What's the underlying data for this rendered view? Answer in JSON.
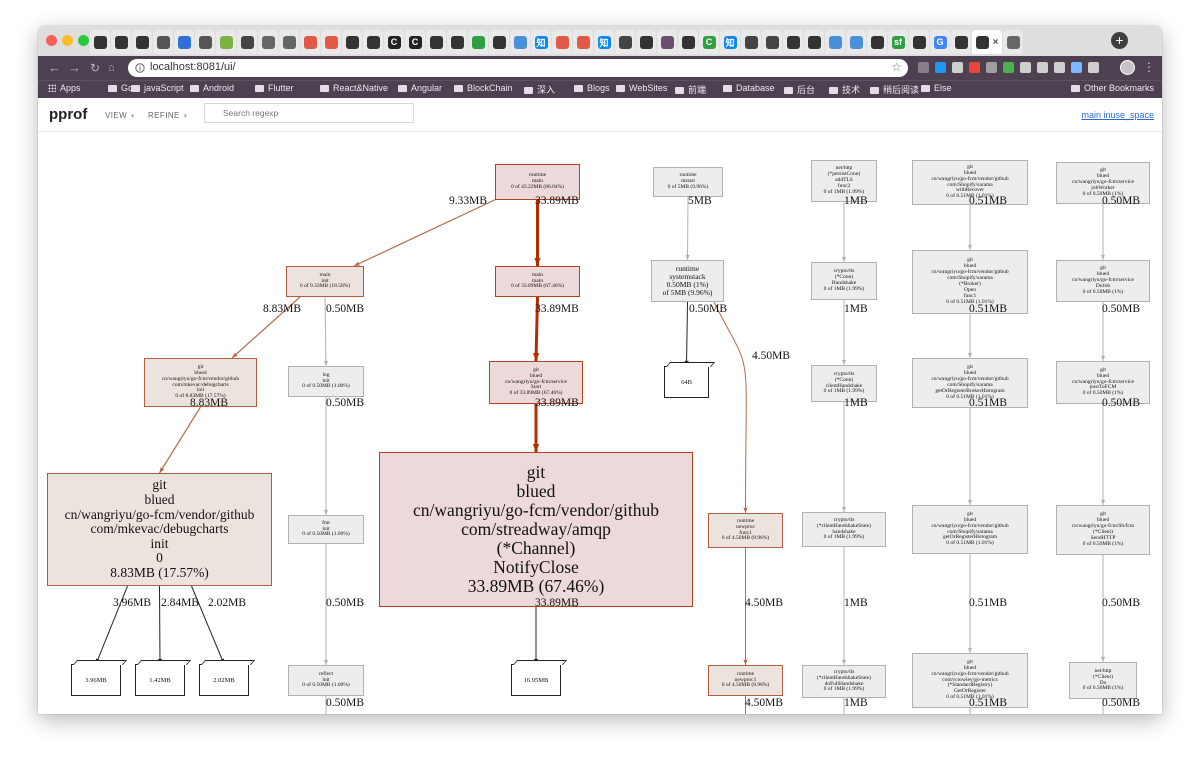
{
  "browser": {
    "url": "localhost:8081/ui/",
    "tab_icons": [
      {
        "glyph": "",
        "color": "#333333"
      },
      {
        "glyph": "",
        "color": "#333333"
      },
      {
        "glyph": "",
        "color": "#333333"
      },
      {
        "glyph": "",
        "color": "#555555"
      },
      {
        "glyph": "",
        "color": "#2f6fd6"
      },
      {
        "glyph": "",
        "color": "#555555"
      },
      {
        "glyph": "",
        "color": "#7cb342"
      },
      {
        "glyph": "",
        "color": "#444444"
      },
      {
        "glyph": "",
        "color": "#666666"
      },
      {
        "glyph": "",
        "color": "#666666"
      },
      {
        "glyph": "",
        "color": "#e05a47"
      },
      {
        "glyph": "",
        "color": "#e05a47"
      },
      {
        "glyph": "",
        "color": "#333333"
      },
      {
        "glyph": "",
        "color": "#333333"
      },
      {
        "glyph": "C",
        "color": "#222222"
      },
      {
        "glyph": "C",
        "color": "#222222"
      },
      {
        "glyph": "",
        "color": "#333333"
      },
      {
        "glyph": "",
        "color": "#333333"
      },
      {
        "glyph": "",
        "color": "#2ea043"
      },
      {
        "glyph": "",
        "color": "#333333"
      },
      {
        "glyph": "",
        "color": "#4a90d9"
      },
      {
        "glyph": "知",
        "color": "#0f88eb"
      },
      {
        "glyph": "",
        "color": "#e05a47"
      },
      {
        "glyph": "",
        "color": "#e05a47"
      },
      {
        "glyph": "知",
        "color": "#0f88eb"
      },
      {
        "glyph": "",
        "color": "#444444"
      },
      {
        "glyph": "",
        "color": "#333333"
      },
      {
        "glyph": "",
        "color": "#6b4d6f"
      },
      {
        "glyph": "",
        "color": "#333333"
      },
      {
        "glyph": "C",
        "color": "#2ea043"
      },
      {
        "glyph": "知",
        "color": "#0f88eb"
      },
      {
        "glyph": "",
        "color": "#444444"
      },
      {
        "glyph": "",
        "color": "#444444"
      },
      {
        "glyph": "",
        "color": "#333333"
      },
      {
        "glyph": "",
        "color": "#333333"
      },
      {
        "glyph": "",
        "color": "#4a90d9"
      },
      {
        "glyph": "",
        "color": "#4a90d9"
      },
      {
        "glyph": "",
        "color": "#333333"
      },
      {
        "glyph": "sf",
        "color": "#2ea043"
      },
      {
        "glyph": "",
        "color": "#333333"
      },
      {
        "glyph": "G",
        "color": "#4285f4"
      },
      {
        "glyph": "",
        "color": "#333333"
      },
      {
        "glyph": "",
        "color": "#333333"
      },
      {
        "glyph": "",
        "color": "#666666"
      }
    ],
    "extension_colors": [
      "#8a7d8c",
      "#2196f3",
      "#cfcfcf",
      "#e8453c",
      "#9e9e9e",
      "#4caf50",
      "#cfcfcf",
      "#cfcfcf",
      "#cfcfcf",
      "#7ab8ff",
      "#cfcfcf"
    ],
    "bookmarks": [
      "Apps",
      "Go",
      "javaScript",
      "Android",
      "Flutter",
      "React&Native",
      "Angular",
      "BlockChain",
      "深入",
      "Blogs",
      "WebSites",
      "前端",
      "Database",
      "后台",
      "技术",
      "稍后阅读",
      "Else"
    ],
    "other_bookmarks": "Other Bookmarks"
  },
  "pprof": {
    "logo": "pprof",
    "view_menu": "VIEW",
    "refine_menu": "REFINE",
    "search_placeholder": "Search regexp",
    "sample_type": "main inuse_space"
  },
  "graph": {
    "colors": {
      "hot_fill": "#edd9d9",
      "hot_border": "#b2421f",
      "warm_fill": "#ede3de",
      "warm_border": "#b25e3e",
      "cold_fill": "#ededed",
      "cold_border": "#b2b2b2",
      "hot_edge": "#b22e00",
      "warm_edge": "#b26d4e",
      "cold_edge": "#b2b2b2",
      "dark_edge": "#222222"
    },
    "nodes": [
      {
        "id": "n_runtime_main",
        "lines": [
          "runtime",
          "main",
          "0 of 43.22MB (86.04%)"
        ],
        "heat": "hot"
      },
      {
        "id": "n_main_init",
        "lines": [
          "main",
          "init",
          "0 of 9.33MB (18.58%)"
        ],
        "heat": "warm"
      },
      {
        "id": "n_main_main",
        "lines": [
          "main",
          "main",
          "0 of 33.89MB (67.46%)"
        ],
        "heat": "hot"
      },
      {
        "id": "n_debugcharts_init",
        "lines": [
          "git",
          "blued",
          "cn/wangriyu/go-fcm/vendor/github",
          "com/mkevac/debugcharts",
          "init",
          "0 of 8.83MB (17.57%)"
        ],
        "heat": "warm"
      },
      {
        "id": "n_log_init",
        "lines": [
          "log",
          "init",
          "0 of 0.50MB (1.00%)"
        ],
        "heat": "cold"
      },
      {
        "id": "n_service_start",
        "lines": [
          "git",
          "blued",
          "cn/wangriyu/go-fcm/service",
          "Start",
          "0 of 33.89MB (67.46%)"
        ],
        "heat": "hot"
      },
      {
        "id": "n_debugcharts_init0",
        "lines": [
          "git",
          "blued",
          "cn/wangriyu/go-fcm/vendor/github",
          "com/mkevac/debugcharts",
          "init",
          "0",
          "8.83MB (17.57%)"
        ],
        "heat": "warm"
      },
      {
        "id": "n_fmt_init",
        "lines": [
          "fmt",
          "init",
          "0 of 0.50MB (1.00%)"
        ],
        "heat": "cold"
      },
      {
        "id": "n_notifyclose",
        "lines": [
          "git",
          "blued",
          "cn/wangriyu/go-fcm/vendor/github",
          "com/streadway/amqp",
          "(*Channel)",
          "NotifyClose",
          "33.89MB (67.46%)"
        ],
        "heat": "hot"
      },
      {
        "id": "n_reflect_init",
        "lines": [
          "reflect",
          "init",
          "0 of 0.50MB (1.00%)"
        ],
        "heat": "cold"
      },
      {
        "id": "n_runtime_mstart",
        "lines": [
          "runtime",
          "mstart",
          "0 of 5MB (9.96%)"
        ],
        "heat": "cold"
      },
      {
        "id": "n_systemstack",
        "lines": [
          "runtime",
          "systemstack",
          "0.50MB (1%)",
          "of 5MB (9.96%)"
        ],
        "heat": "cold"
      },
      {
        "id": "n_newproc_func1",
        "lines": [
          "runtime",
          "newproc",
          "func1",
          "0 of 4.50MB (8.96%)"
        ],
        "heat": "warm"
      },
      {
        "id": "n_newproc1",
        "lines": [
          "runtime",
          "newproc1",
          "0 of 4.50MB (8.96%)"
        ],
        "heat": "warm"
      },
      {
        "id": "n_addtls",
        "lines": [
          "net/http",
          "(*persistConn)",
          "addTLS",
          "func2",
          "0 of 1MB (1.99%)"
        ],
        "heat": "cold"
      },
      {
        "id": "n_tls_handshake",
        "lines": [
          "crypto/tls",
          "(*Conn)",
          "Handshake",
          "0 of 1MB (1.99%)"
        ],
        "heat": "cold"
      },
      {
        "id": "n_client_handshake",
        "lines": [
          "crypto/tls",
          "(*Conn)",
          "clientHandshake",
          "0 of 1MB (1.99%)"
        ],
        "heat": "cold"
      },
      {
        "id": "n_hs_state_handshake",
        "lines": [
          "crypto/tls",
          "(*clientHandshakeState)",
          "handshake",
          "0 of 1MB (1.99%)"
        ],
        "heat": "cold"
      },
      {
        "id": "n_full_handshake",
        "lines": [
          "crypto/tls",
          "(*clientHandshakeState)",
          "doFullHandshake",
          "0 of 1MB (1.99%)"
        ],
        "heat": "cold"
      },
      {
        "id": "n_sarama_recover",
        "lines": [
          "git",
          "blued",
          "cn/wangriyu/go-fcm/vendor/github",
          "com/Shopify/sarama",
          "withRecover",
          "0 of 0.51MB (1.01%)"
        ],
        "heat": "cold"
      },
      {
        "id": "n_sarama_broker_open",
        "lines": [
          "git",
          "blued",
          "cn/wangriyu/go-fcm/vendor/github",
          "com/Shopify/sarama",
          "(*Broker)",
          "Open",
          "func1",
          "0 of 0.51MB (1.01%)"
        ],
        "heat": "cold"
      },
      {
        "id": "n_sarama_histogram",
        "lines": [
          "git",
          "blued",
          "cn/wangriyu/go-fcm/vendor/github",
          "com/Shopify/sarama",
          "getOrRegisterBrokerHistogram",
          "0 of 0.51MB (1.01%)"
        ],
        "heat": "cold"
      },
      {
        "id": "n_sarama_gethist",
        "lines": [
          "git",
          "blued",
          "cn/wangriyu/go-fcm/vendor/github",
          "com/Shopify/sarama",
          "getOrRegisterHistogram",
          "0 of 0.51MB (1.01%)"
        ],
        "heat": "cold"
      },
      {
        "id": "n_metrics_gethist",
        "lines": [
          "git",
          "blued",
          "cn/wangriyu/go-fcm/vendor/github",
          "com/rcrowley/go-metrics",
          "(*StandardRegistry)",
          "GetOrRegister",
          "0 of 0.51MB (1.01%)"
        ],
        "heat": "cold"
      },
      {
        "id": "n_job_worker",
        "lines": [
          "git",
          "blued",
          "cn/wangriyu/go-fcm/service",
          "jobWorker",
          "0 of 0.50MB (1%)"
        ],
        "heat": "cold"
      },
      {
        "id": "n_dojob",
        "lines": [
          "git",
          "blued",
          "cn/wangriyu/go-fcm/service",
          "DoJob",
          "0 of 0.50MB (1%)"
        ],
        "heat": "cold"
      },
      {
        "id": "n_posttofcm",
        "lines": [
          "git",
          "blued",
          "cn/wangriyu/go-fcm/service",
          "postToFCM",
          "0 of 0.50MB (1%)"
        ],
        "heat": "cold"
      },
      {
        "id": "n_sendhttp",
        "lines": [
          "git",
          "blued",
          "cn/wangriyu/go-fcm/lib/fcm",
          "(*Client)",
          "SendHTTP",
          "0 of 0.50MB (1%)"
        ],
        "heat": "cold"
      },
      {
        "id": "n_client_do",
        "lines": [
          "net/http",
          "(*Client)",
          "Do",
          "0 of 0.50MB (1%)"
        ],
        "heat": "cold"
      }
    ],
    "leaves": [
      {
        "id": "l_396",
        "label": "3.96MB"
      },
      {
        "id": "l_142",
        "label": "1.42MB"
      },
      {
        "id": "l_202",
        "label": "2.02MB"
      },
      {
        "id": "l_1695",
        "label": "16.95MB"
      },
      {
        "id": "l_64b",
        "label": "64B"
      }
    ],
    "edges": [
      {
        "id": "e1",
        "from": "n_runtime_main",
        "to": "n_main_init",
        "label": "9.33MB",
        "style": "warm",
        "width": 1.2
      },
      {
        "id": "e2",
        "from": "n_runtime_main",
        "to": "n_main_main",
        "label": "33.89MB",
        "style": "hot",
        "width": 3
      },
      {
        "id": "e3",
        "from": "n_main_init",
        "to": "n_debugcharts_init",
        "label": "8.83MB",
        "style": "warm",
        "width": 1.2
      },
      {
        "id": "e4",
        "from": "n_main_init",
        "to": "n_log_init",
        "label": "0.50MB",
        "style": "cold",
        "width": 1
      },
      {
        "id": "e5",
        "from": "n_main_main",
        "to": "n_service_start",
        "label": "33.89MB",
        "style": "hot",
        "width": 3
      },
      {
        "id": "e6",
        "from": "n_debugcharts_init",
        "to": "n_debugcharts_init0",
        "label": "8.83MB",
        "style": "warm",
        "width": 1.2
      },
      {
        "id": "e7",
        "from": "n_log_init",
        "to": "n_fmt_init",
        "label": "0.50MB",
        "style": "cold",
        "width": 1
      },
      {
        "id": "e8",
        "from": "n_service_start",
        "to": "n_notifyclose",
        "label": "33.89MB",
        "style": "hot",
        "width": 3
      },
      {
        "id": "e9",
        "from": "n_debugcharts_init0",
        "to": "l_396",
        "label": "3.96MB",
        "style": "dark",
        "width": 1
      },
      {
        "id": "e10",
        "from": "n_debugcharts_init0",
        "to": "l_142",
        "label": "2.84MB",
        "style": "dark",
        "width": 1
      },
      {
        "id": "e11",
        "from": "n_debugcharts_init0",
        "to": "l_202",
        "label": "2.02MB",
        "style": "dark",
        "width": 1
      },
      {
        "id": "e12",
        "from": "n_fmt_init",
        "to": "n_reflect_init",
        "label": "0.50MB",
        "style": "cold",
        "width": 1
      },
      {
        "id": "e13",
        "from": "n_notifyclose",
        "to": "l_1695",
        "label": "33.89MB",
        "style": "dark",
        "width": 1
      },
      {
        "id": "e14",
        "from": "n_reflect_init",
        "to": null,
        "label": "0.50MB",
        "style": "cold",
        "width": 1
      },
      {
        "id": "e15",
        "from": "n_runtime_mstart",
        "to": "n_systemstack",
        "label": "5MB",
        "style": "cold",
        "width": 1
      },
      {
        "id": "e16",
        "from": "n_systemstack",
        "to": "l_64b",
        "label": "0.50MB",
        "style": "dark",
        "width": 1
      },
      {
        "id": "e17",
        "from": "n_systemstack",
        "to": "n_newproc_func1",
        "label": "4.50MB",
        "style": "warm",
        "width": 1
      },
      {
        "id": "e18",
        "from": "n_newproc_func1",
        "to": "n_newproc1",
        "label": "4.50MB",
        "style": "warm",
        "width": 1
      },
      {
        "id": "e19",
        "from": "n_newproc1",
        "to": null,
        "label": "4.50MB",
        "style": "warm",
        "width": 1
      },
      {
        "id": "e20",
        "from": "n_addtls",
        "to": "n_tls_handshake",
        "label": "1MB",
        "style": "cold",
        "width": 1
      },
      {
        "id": "e21",
        "from": "n_tls_handshake",
        "to": "n_client_handshake",
        "label": "1MB",
        "style": "cold",
        "width": 1
      },
      {
        "id": "e22",
        "from": "n_client_handshake",
        "to": "n_hs_state_handshake",
        "label": "1MB",
        "style": "cold",
        "width": 1
      },
      {
        "id": "e23",
        "from": "n_hs_state_handshake",
        "to": "n_full_handshake",
        "label": "1MB",
        "style": "cold",
        "width": 1
      },
      {
        "id": "e24",
        "from": "n_full_handshake",
        "to": null,
        "label": "1MB",
        "style": "cold",
        "width": 1
      },
      {
        "id": "e25",
        "from": "n_sarama_recover",
        "to": "n_sarama_broker_open",
        "label": "0.51MB",
        "style": "cold",
        "width": 1
      },
      {
        "id": "e26",
        "from": "n_sarama_broker_open",
        "to": "n_sarama_histogram",
        "label": "0.51MB",
        "style": "cold",
        "width": 1
      },
      {
        "id": "e27",
        "from": "n_sarama_histogram",
        "to": "n_sarama_gethist",
        "label": "0.51MB",
        "style": "cold",
        "width": 1
      },
      {
        "id": "e28",
        "from": "n_sarama_gethist",
        "to": "n_metrics_gethist",
        "label": "0.51MB",
        "style": "cold",
        "width": 1
      },
      {
        "id": "e29",
        "from": "n_metrics_gethist",
        "to": null,
        "label": "0.51MB",
        "style": "cold",
        "width": 1
      },
      {
        "id": "e30",
        "from": "n_job_worker",
        "to": "n_dojob",
        "label": "0.50MB",
        "style": "cold",
        "width": 1
      },
      {
        "id": "e31",
        "from": "n_dojob",
        "to": "n_posttofcm",
        "label": "0.50MB",
        "style": "cold",
        "width": 1
      },
      {
        "id": "e32",
        "from": "n_posttofcm",
        "to": "n_sendhttp",
        "label": "0.50MB",
        "style": "cold",
        "width": 1
      },
      {
        "id": "e33",
        "from": "n_sendhttp",
        "to": "n_client_do",
        "label": "0.50MB",
        "style": "cold",
        "width": 1
      },
      {
        "id": "e34",
        "from": "n_client_do",
        "to": null,
        "label": "0.50MB",
        "style": "cold",
        "width": 1
      }
    ]
  }
}
